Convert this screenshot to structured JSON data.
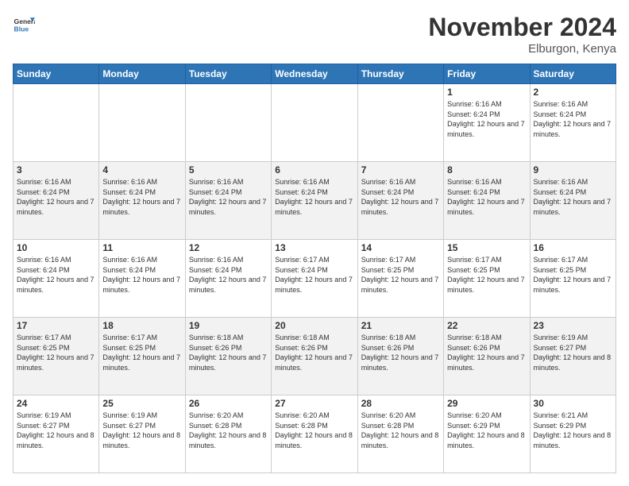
{
  "logo": {
    "line1": "General",
    "line2": "Blue"
  },
  "title": "November 2024",
  "location": "Elburgon, Kenya",
  "days_of_week": [
    "Sunday",
    "Monday",
    "Tuesday",
    "Wednesday",
    "Thursday",
    "Friday",
    "Saturday"
  ],
  "weeks": [
    [
      {
        "day": "",
        "info": ""
      },
      {
        "day": "",
        "info": ""
      },
      {
        "day": "",
        "info": ""
      },
      {
        "day": "",
        "info": ""
      },
      {
        "day": "",
        "info": ""
      },
      {
        "day": "1",
        "info": "Sunrise: 6:16 AM\nSunset: 6:24 PM\nDaylight: 12 hours and 7 minutes."
      },
      {
        "day": "2",
        "info": "Sunrise: 6:16 AM\nSunset: 6:24 PM\nDaylight: 12 hours and 7 minutes."
      }
    ],
    [
      {
        "day": "3",
        "info": "Sunrise: 6:16 AM\nSunset: 6:24 PM\nDaylight: 12 hours and 7 minutes."
      },
      {
        "day": "4",
        "info": "Sunrise: 6:16 AM\nSunset: 6:24 PM\nDaylight: 12 hours and 7 minutes."
      },
      {
        "day": "5",
        "info": "Sunrise: 6:16 AM\nSunset: 6:24 PM\nDaylight: 12 hours and 7 minutes."
      },
      {
        "day": "6",
        "info": "Sunrise: 6:16 AM\nSunset: 6:24 PM\nDaylight: 12 hours and 7 minutes."
      },
      {
        "day": "7",
        "info": "Sunrise: 6:16 AM\nSunset: 6:24 PM\nDaylight: 12 hours and 7 minutes."
      },
      {
        "day": "8",
        "info": "Sunrise: 6:16 AM\nSunset: 6:24 PM\nDaylight: 12 hours and 7 minutes."
      },
      {
        "day": "9",
        "info": "Sunrise: 6:16 AM\nSunset: 6:24 PM\nDaylight: 12 hours and 7 minutes."
      }
    ],
    [
      {
        "day": "10",
        "info": "Sunrise: 6:16 AM\nSunset: 6:24 PM\nDaylight: 12 hours and 7 minutes."
      },
      {
        "day": "11",
        "info": "Sunrise: 6:16 AM\nSunset: 6:24 PM\nDaylight: 12 hours and 7 minutes."
      },
      {
        "day": "12",
        "info": "Sunrise: 6:16 AM\nSunset: 6:24 PM\nDaylight: 12 hours and 7 minutes."
      },
      {
        "day": "13",
        "info": "Sunrise: 6:17 AM\nSunset: 6:24 PM\nDaylight: 12 hours and 7 minutes."
      },
      {
        "day": "14",
        "info": "Sunrise: 6:17 AM\nSunset: 6:25 PM\nDaylight: 12 hours and 7 minutes."
      },
      {
        "day": "15",
        "info": "Sunrise: 6:17 AM\nSunset: 6:25 PM\nDaylight: 12 hours and 7 minutes."
      },
      {
        "day": "16",
        "info": "Sunrise: 6:17 AM\nSunset: 6:25 PM\nDaylight: 12 hours and 7 minutes."
      }
    ],
    [
      {
        "day": "17",
        "info": "Sunrise: 6:17 AM\nSunset: 6:25 PM\nDaylight: 12 hours and 7 minutes."
      },
      {
        "day": "18",
        "info": "Sunrise: 6:17 AM\nSunset: 6:25 PM\nDaylight: 12 hours and 7 minutes."
      },
      {
        "day": "19",
        "info": "Sunrise: 6:18 AM\nSunset: 6:26 PM\nDaylight: 12 hours and 7 minutes."
      },
      {
        "day": "20",
        "info": "Sunrise: 6:18 AM\nSunset: 6:26 PM\nDaylight: 12 hours and 7 minutes."
      },
      {
        "day": "21",
        "info": "Sunrise: 6:18 AM\nSunset: 6:26 PM\nDaylight: 12 hours and 7 minutes."
      },
      {
        "day": "22",
        "info": "Sunrise: 6:18 AM\nSunset: 6:26 PM\nDaylight: 12 hours and 7 minutes."
      },
      {
        "day": "23",
        "info": "Sunrise: 6:19 AM\nSunset: 6:27 PM\nDaylight: 12 hours and 8 minutes."
      }
    ],
    [
      {
        "day": "24",
        "info": "Sunrise: 6:19 AM\nSunset: 6:27 PM\nDaylight: 12 hours and 8 minutes."
      },
      {
        "day": "25",
        "info": "Sunrise: 6:19 AM\nSunset: 6:27 PM\nDaylight: 12 hours and 8 minutes."
      },
      {
        "day": "26",
        "info": "Sunrise: 6:20 AM\nSunset: 6:28 PM\nDaylight: 12 hours and 8 minutes."
      },
      {
        "day": "27",
        "info": "Sunrise: 6:20 AM\nSunset: 6:28 PM\nDaylight: 12 hours and 8 minutes."
      },
      {
        "day": "28",
        "info": "Sunrise: 6:20 AM\nSunset: 6:28 PM\nDaylight: 12 hours and 8 minutes."
      },
      {
        "day": "29",
        "info": "Sunrise: 6:20 AM\nSunset: 6:29 PM\nDaylight: 12 hours and 8 minutes."
      },
      {
        "day": "30",
        "info": "Sunrise: 6:21 AM\nSunset: 6:29 PM\nDaylight: 12 hours and 8 minutes."
      }
    ]
  ]
}
